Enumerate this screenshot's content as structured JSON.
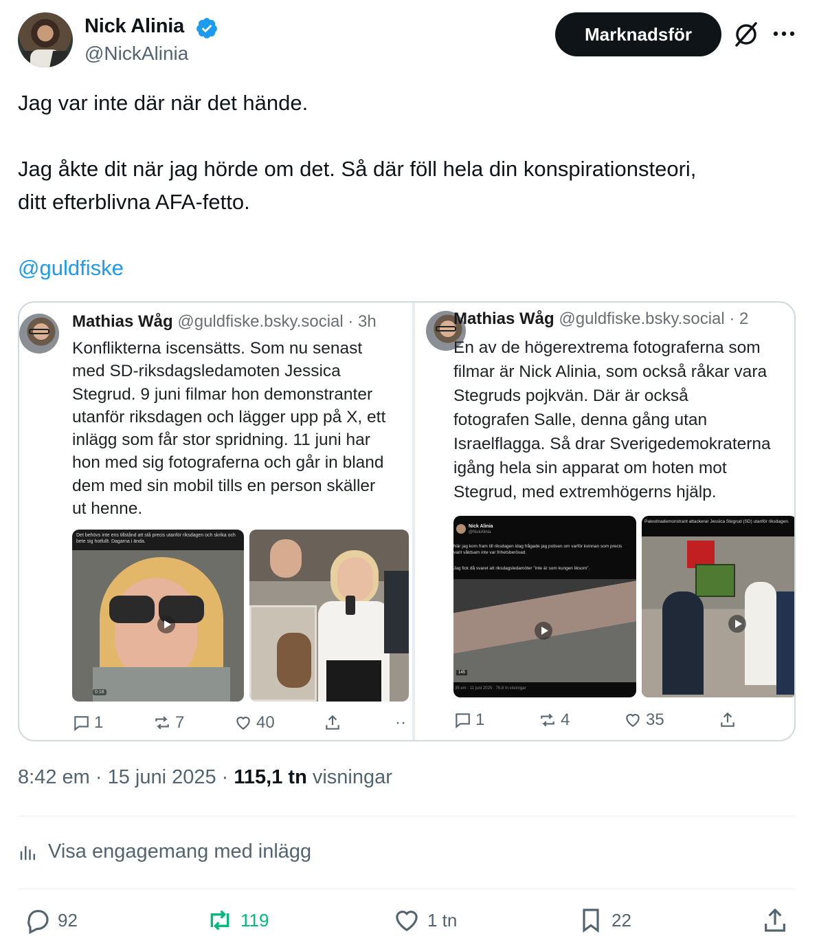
{
  "author": {
    "name": "Nick Alinia",
    "handle": "@NickAlinia",
    "verified": true
  },
  "header": {
    "promote_label": "Marknadsför",
    "grok_icon": "grok-icon",
    "more_icon": "more-icon"
  },
  "tweet": {
    "lines": [
      "Jag var inte där när det hände.",
      "",
      "Jag åkte dit när jag hörde om det. Så där föll hela din konspirationsteori,",
      "ditt efterblivna AFA-fetto.",
      ""
    ],
    "mention": "@guldfiske"
  },
  "quoted_posts": [
    {
      "author_name": "Mathias Wåg",
      "author_handle": "@guldfiske.bsky.social",
      "time": "· 3h",
      "body_lines": [
        "Konflikterna iscensätts. Som nu senast",
        "med SD-riksdagsledamoten Jessica",
        "Stegrud. 9 juni filmar hon demonstranter",
        "utanför riksdagen och lägger upp på X, ett",
        "inlägg som får stor spridning. 11 juni har",
        "hon med sig fotograferna och går in bland",
        "dem med sin mobil tills en person skäller",
        "ut henne."
      ],
      "media": [
        {
          "caption": "Det behövs inte ens tillstånd att stå precis utanför riksdagen och skrika och bete sig hotfullt. Dagarna i ända.",
          "duration": "0:18"
        },
        {
          "caption": ""
        }
      ],
      "replies": "1",
      "reposts": "7",
      "likes": "40",
      "more": "··"
    },
    {
      "author_name": "Mathias Wåg",
      "author_handle": "@guldfiske.bsky.social",
      "time": "· 2",
      "body_lines": [
        "En av de högerextrema fotograferna som",
        "filmar är Nick Alinia, som också råkar vara",
        "Stegruds pojkvän. Där är också",
        "fotografen Salle, denna gång utan",
        "Israelflagga. Så drar Sverigedemokraterna",
        "igång hela sin apparat om hoten mot",
        "Stegrud, med extremhögerns hjälp."
      ],
      "media": [
        {
          "embedded_name": "Nick Alinia",
          "embedded_handle": "@NickAlinia",
          "caption1": "När jag kom fram till riksdagen idag frågade jag polisen om varför kvinnan som precis varit våldsam inte var frihetsberövad.",
          "caption2": "Jag fick då svaret att riksdagsledamöter \"inte är som kungen liksom\".",
          "footer": "35 em · 11 juni 2025 · 76,8 tn visningar",
          "badge": "145"
        },
        {
          "caption": "Palestinademonstrant attackerar Jessica Stegrud (SD) utanför riksdagen."
        }
      ],
      "replies": "1",
      "reposts": "4",
      "likes": "35"
    }
  ],
  "meta": {
    "time": "8:42 em",
    "date": "15 juni 2025",
    "views_count": "115,1 tn",
    "views_label": "visningar"
  },
  "engagement_link": "Visa engagemang med inlägg",
  "actions": {
    "replies": "92",
    "reposts": "119",
    "likes": "1 tn",
    "bookmarks": "22"
  },
  "colors": {
    "accent": "#1d9bf0",
    "repost_active": "#00ba7c",
    "text_secondary": "#536471"
  }
}
